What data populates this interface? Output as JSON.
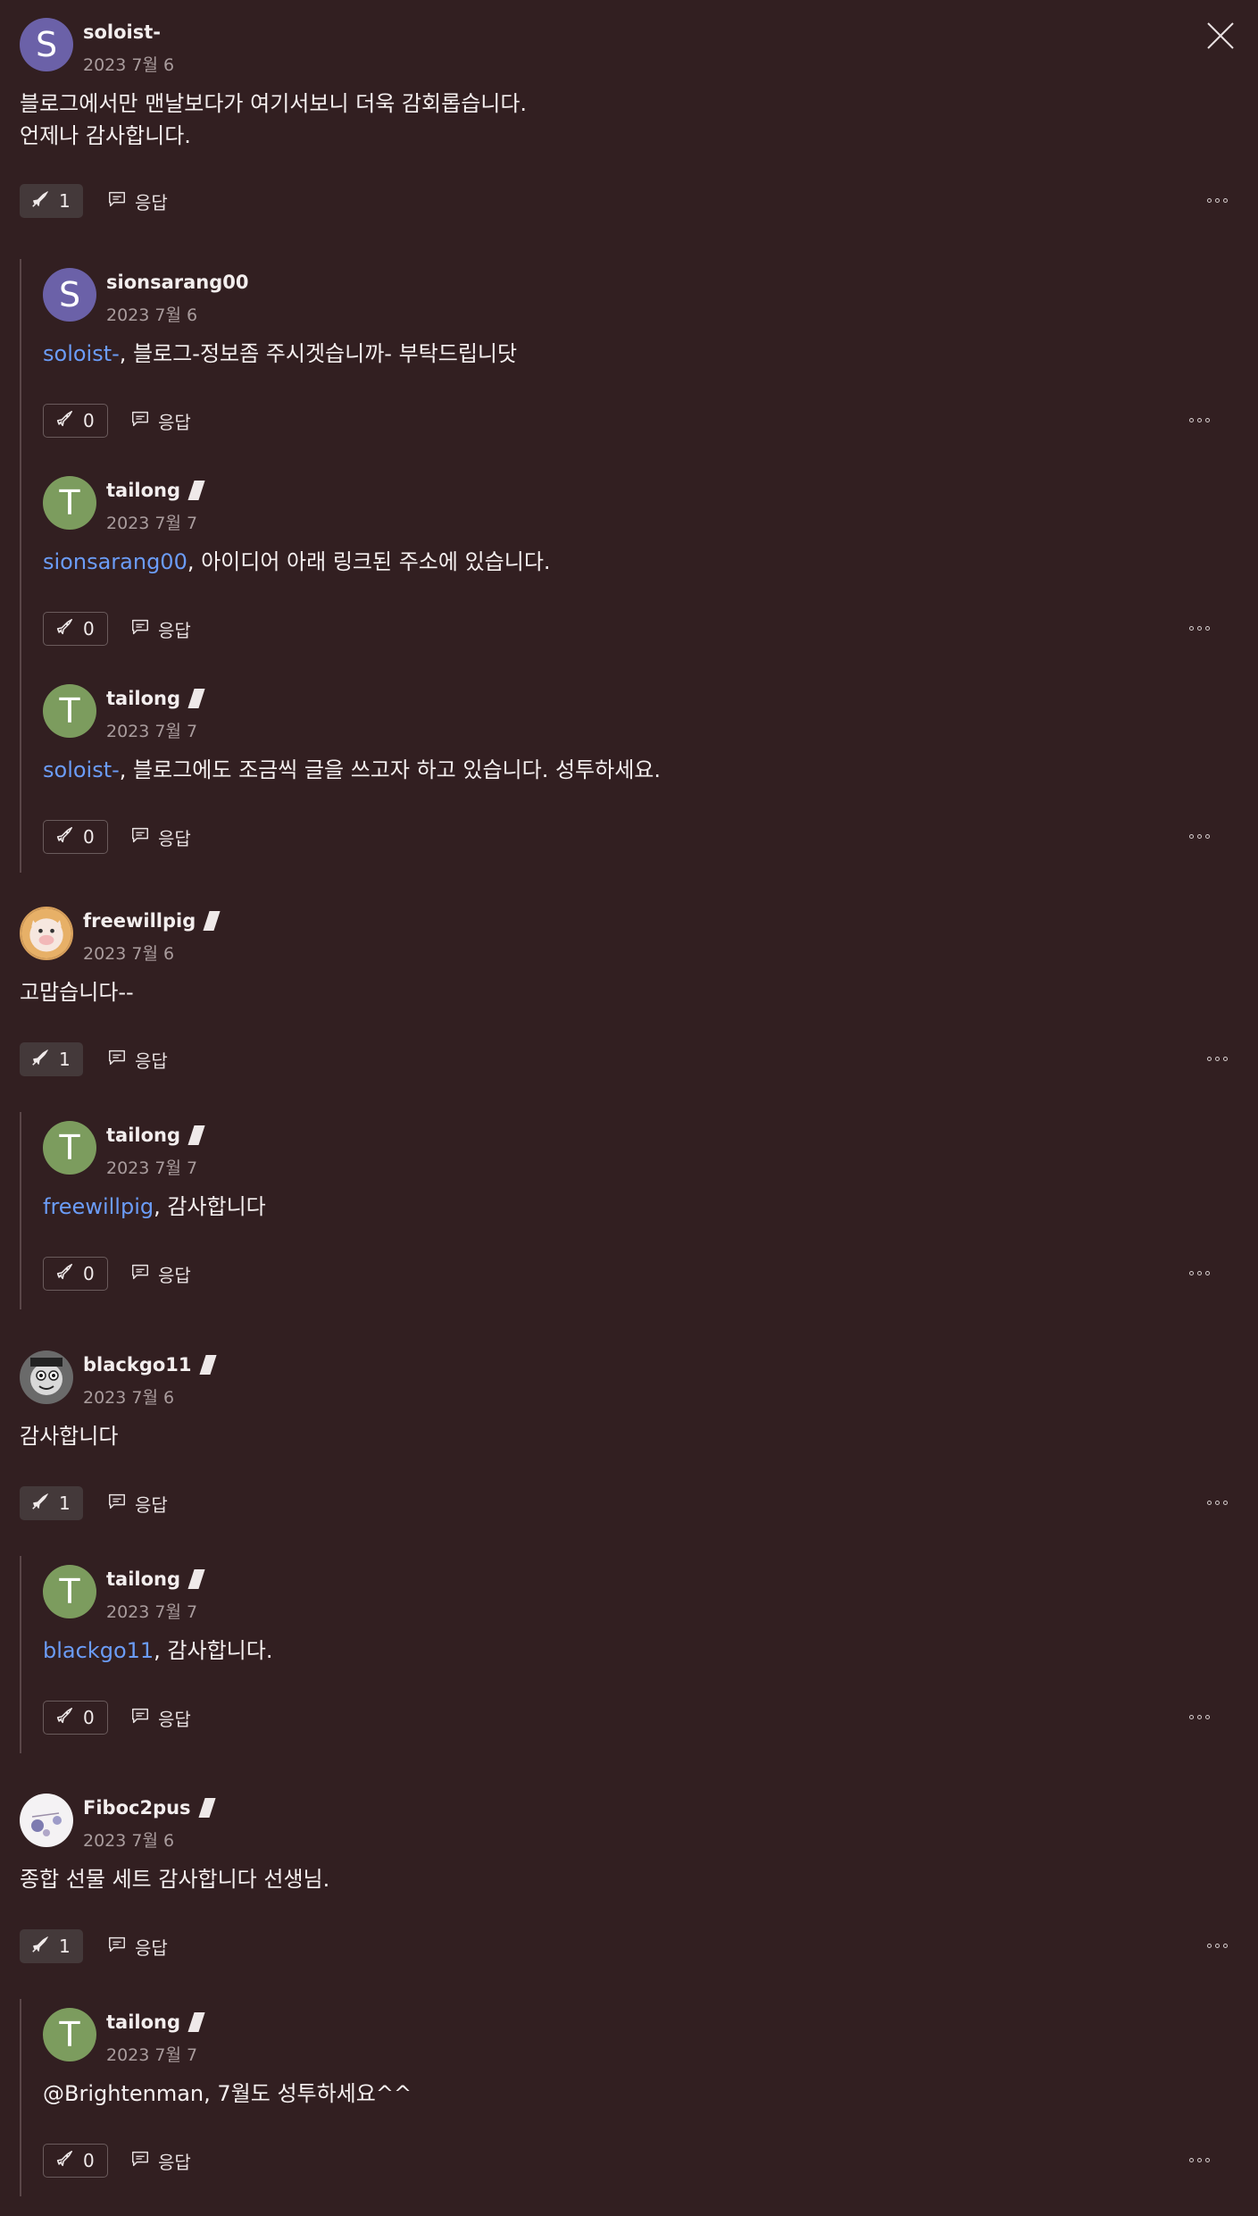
{
  "close_icon": "close-icon",
  "labels": {
    "reply": "응답"
  },
  "threads": [
    {
      "root": {
        "user": "soloist-",
        "date": "2023 7월 6",
        "badge": false,
        "avatar": {
          "letter": "S",
          "color": "#6b61a8"
        },
        "body": "블로그에서만 맨날보다가 여기서보니 더욱 감회롭습니다.\n언제나 감사합니다.",
        "likes": "1"
      },
      "replies": [
        {
          "user": "sionsarang00",
          "date": "2023 7월 6",
          "badge": false,
          "avatar": {
            "letter": "S",
            "color": "#6b61a8"
          },
          "mention": "soloist-",
          "text": ", 블로그-정보좀 주시겟습니까- 부탁드립니닷",
          "likes": "0"
        },
        {
          "user": "tailong",
          "date": "2023 7월 7",
          "badge": true,
          "avatar": {
            "letter": "T",
            "color": "#7c9c5e"
          },
          "mention": "sionsarang00",
          "text": ", 아이디어 아래 링크된 주소에 있습니다.",
          "likes": "0"
        },
        {
          "user": "tailong",
          "date": "2023 7월 7",
          "badge": true,
          "avatar": {
            "letter": "T",
            "color": "#7c9c5e"
          },
          "mention": "soloist-",
          "text": ", 블로그에도 조금씩 글을 쓰고자 하고 있습니다. 성투하세요.",
          "likes": "0"
        }
      ]
    },
    {
      "root": {
        "user": "freewillpig",
        "date": "2023 7월 6",
        "badge": true,
        "avatar": {
          "letter": "",
          "color": "#d9a15c"
        },
        "body": "고맙습니다--",
        "likes": "1"
      },
      "replies": [
        {
          "user": "tailong",
          "date": "2023 7월 7",
          "badge": true,
          "avatar": {
            "letter": "T",
            "color": "#7c9c5e"
          },
          "mention": "freewillpig",
          "text": ", 감사합니다",
          "likes": "0"
        }
      ]
    },
    {
      "root": {
        "user": "blackgo11",
        "date": "2023 7월 6",
        "badge": true,
        "avatar": {
          "letter": "",
          "color": "#8b8b8b"
        },
        "body": "감사합니다",
        "likes": "1"
      },
      "replies": [
        {
          "user": "tailong",
          "date": "2023 7월 7",
          "badge": true,
          "avatar": {
            "letter": "T",
            "color": "#7c9c5e"
          },
          "mention": "blackgo11",
          "text": ", 감사합니다.",
          "likes": "0"
        }
      ]
    },
    {
      "root": {
        "user": "Fiboc2pus",
        "date": "2023 7월 6",
        "badge": true,
        "avatar": {
          "letter": "",
          "color": "#f4f2f4"
        },
        "body": "종합 선물 세트 감사합니다 선생님.",
        "likes": "1"
      },
      "replies": [
        {
          "user": "tailong",
          "date": "2023 7월 7",
          "badge": true,
          "avatar": {
            "letter": "T",
            "color": "#7c9c5e"
          },
          "mention": "",
          "text": "@Brightenman, 7월도 성투하세요^^",
          "likes": "0"
        }
      ]
    }
  ]
}
